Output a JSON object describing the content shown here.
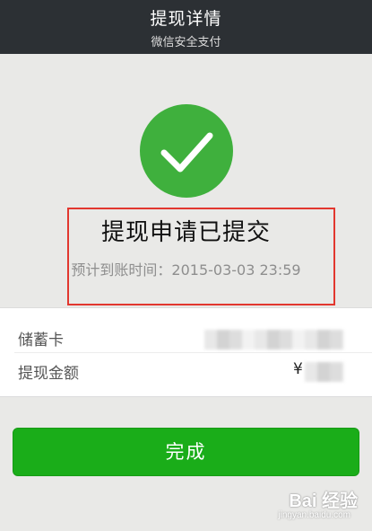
{
  "header": {
    "title": "提现详情",
    "subtitle": "微信安全支付"
  },
  "status": {
    "icon": "check-icon",
    "title": "提现申请已提交",
    "eta_label": "预计到账时间：",
    "eta_value": "2015-03-03 23:59",
    "eta_text": "预计到账时间：2015-03-03 23:59"
  },
  "details": {
    "rows": [
      {
        "label": "储蓄卡",
        "value_visible": ""
      },
      {
        "label": "提现金额",
        "value_visible": "¥"
      }
    ]
  },
  "action": {
    "done_label": "完成"
  },
  "watermark": {
    "text": "Bai 经验",
    "sub": "jingyan.baidu.com"
  },
  "colors": {
    "header_bg": "#2c3034",
    "success_green": "#3fb03d",
    "button_green": "#1aad19",
    "highlight_red": "#e2372f",
    "page_bg": "#e9e9e7"
  }
}
